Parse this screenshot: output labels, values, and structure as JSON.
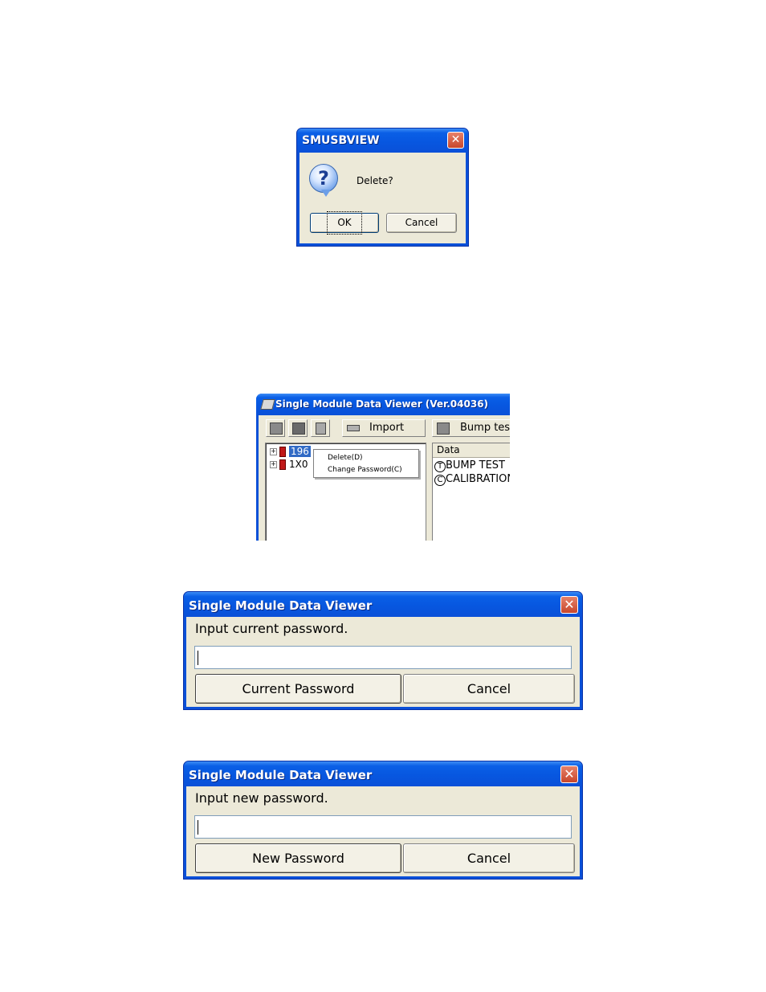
{
  "dialog_delete": {
    "title": "SMUSBVIEW",
    "icon": "question-icon",
    "message": "Delete?",
    "ok_label": "OK",
    "cancel_label": "Cancel",
    "close_glyph": "✕"
  },
  "app": {
    "title": "Single Module Data Viewer (Ver.04036)",
    "toolbar": {
      "import_label": "Import",
      "bump_test_label": "Bump test"
    },
    "tree": {
      "items": [
        {
          "label": "196",
          "selected": true
        },
        {
          "label": "1X0",
          "selected": false
        }
      ]
    },
    "context_menu": {
      "items": [
        {
          "label": "Delete(D)"
        },
        {
          "label": "Change Password(C)"
        }
      ]
    },
    "data_list": {
      "header": "Data",
      "rows": [
        {
          "badge": "T",
          "label": "BUMP TEST"
        },
        {
          "badge": "C",
          "label": "CALIBRATION"
        }
      ]
    }
  },
  "dialog_current_password": {
    "title": "Single Module Data Viewer",
    "prompt": "Input current password.",
    "input_value": "",
    "confirm_label": "Current Password",
    "cancel_label": "Cancel",
    "close_glyph": "✕"
  },
  "dialog_new_password": {
    "title": "Single Module Data Viewer",
    "prompt": "Input new password.",
    "input_value": "",
    "confirm_label": "New Password",
    "cancel_label": "Cancel",
    "close_glyph": "✕"
  }
}
